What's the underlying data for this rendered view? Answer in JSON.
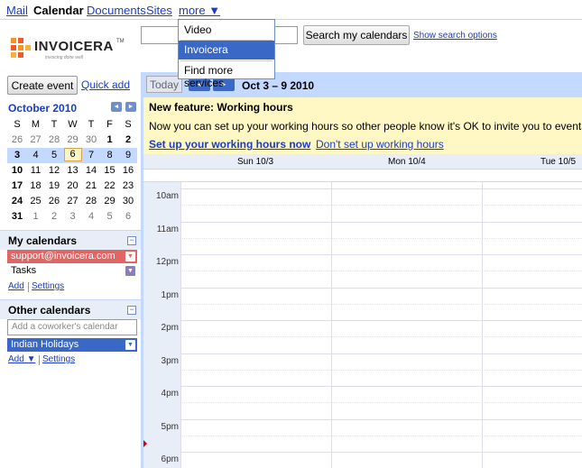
{
  "topnav": {
    "mail": "Mail",
    "calendar": "Calendar",
    "documents": "Documents",
    "sites": "Sites",
    "more": "more ▼"
  },
  "more_menu": {
    "items": [
      "Video",
      "Invoicera",
      "Find more services"
    ],
    "selected": "Invoicera"
  },
  "logo": {
    "name": "INVOICERA",
    "tm": "TM",
    "tagline": "invoicing done well"
  },
  "search": {
    "value": "",
    "button": "Search my calendars",
    "options_link": "Show search options"
  },
  "create_event": "Create event",
  "quick_add": "Quick add",
  "mini_calendar": {
    "month": "October 2010",
    "prev_icon": "◄",
    "next_icon": "►",
    "weekdays": [
      "S",
      "M",
      "T",
      "W",
      "T",
      "F",
      "S"
    ],
    "weeks": [
      [
        "26",
        "27",
        "28",
        "29",
        "30",
        "1",
        "2"
      ],
      [
        "3",
        "4",
        "5",
        "6",
        "7",
        "8",
        "9"
      ],
      [
        "10",
        "11",
        "12",
        "13",
        "14",
        "15",
        "16"
      ],
      [
        "17",
        "18",
        "19",
        "20",
        "21",
        "22",
        "23"
      ],
      [
        "24",
        "25",
        "26",
        "27",
        "28",
        "29",
        "30"
      ],
      [
        "31",
        "1",
        "2",
        "3",
        "4",
        "5",
        "6"
      ]
    ],
    "today": "6"
  },
  "my_calendars": {
    "title": "My calendars",
    "items": [
      {
        "name": "support@invoicera.com",
        "color": "#e06666"
      },
      {
        "name": "Tasks",
        "color": "#ffffff"
      }
    ],
    "add": "Add",
    "settings": "Settings"
  },
  "other_calendars": {
    "title": "Other calendars",
    "placeholder": "Add a coworker's calendar",
    "items": [
      {
        "name": "Indian Holidays",
        "color": "#3968c6"
      }
    ],
    "add": "Add ▼",
    "settings": "Settings"
  },
  "toolbar": {
    "today": "Today",
    "range": "Oct 3 – 9 2010"
  },
  "feature": {
    "title": "New feature: Working hours",
    "text": "Now you can set up your working hours so other people know it's OK to invite you to events. You",
    "setup": "Set up your working hours now",
    "dismiss": "Don't set up working hours"
  },
  "days": [
    "Sun 10/3",
    "Mon 10/4",
    "Tue 10/5"
  ],
  "hours": [
    "10am",
    "11am",
    "12pm",
    "1pm",
    "2pm",
    "3pm",
    "4pm",
    "5pm",
    "6pm"
  ],
  "colors": {
    "accent": "#3968c6",
    "panel": "#c3d9ff",
    "banner": "#fff8c4"
  }
}
